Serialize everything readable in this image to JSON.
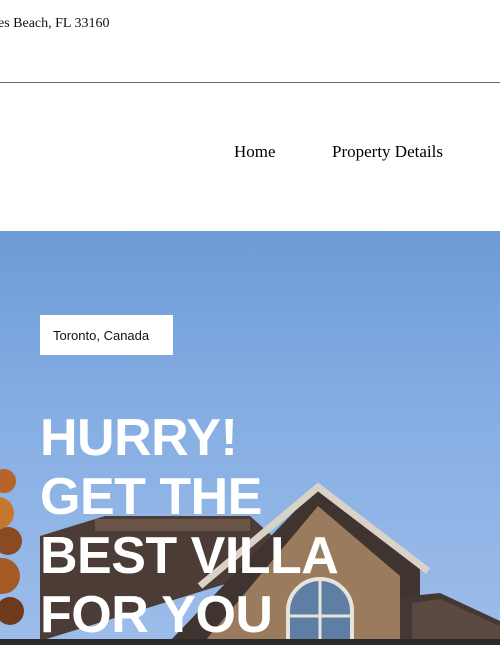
{
  "topbar": {
    "address": "es Beach, FL 33160"
  },
  "nav": {
    "home": "Home",
    "property_details": "Property Details"
  },
  "hero": {
    "location": "Toronto, Canada",
    "headline": [
      "HURRY!",
      "GET THE",
      "BEST VILLA",
      "FOR YOU"
    ]
  },
  "colors": {
    "sky": "#7fa8df",
    "headline": "#ffffff",
    "roof": "#5a4a42",
    "brick": "#9a7a5c"
  }
}
